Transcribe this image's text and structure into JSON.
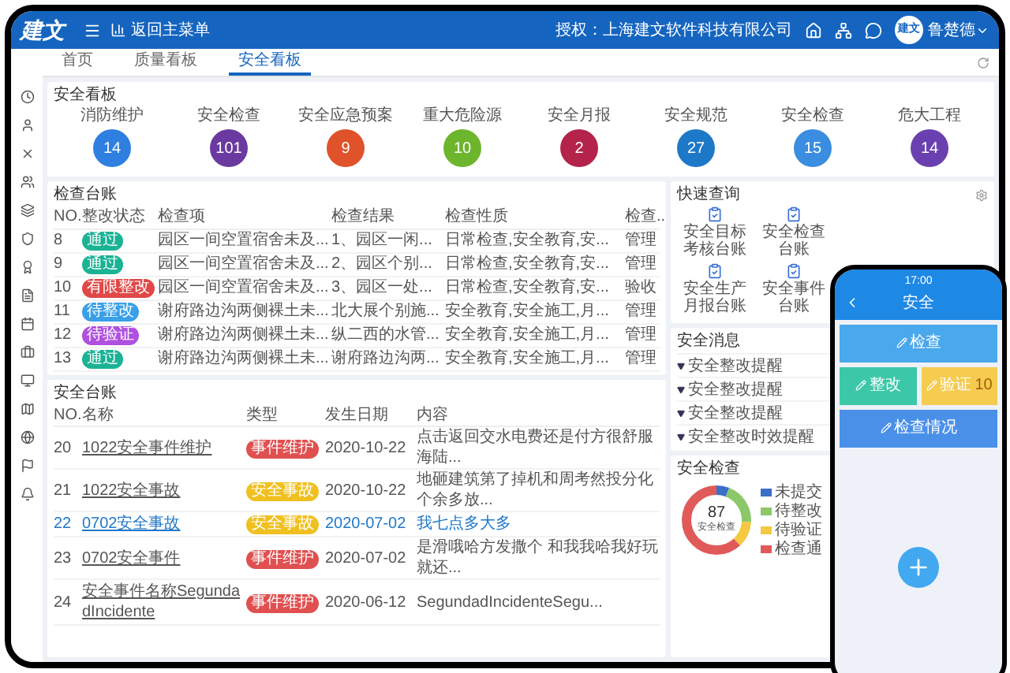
{
  "header": {
    "logo": "建文",
    "back": "返回主菜单",
    "license": "授权：上海建文软件科技有限公司",
    "avatar": "建文",
    "user": "鲁楚德"
  },
  "tabs": [
    {
      "label": "首页",
      "selected": false
    },
    {
      "label": "质量看板",
      "selected": false
    },
    {
      "label": "安全看板",
      "selected": true
    }
  ],
  "stats": {
    "title": "安全看板",
    "items": [
      {
        "label": "消防维护",
        "value": "14",
        "color": "#2f7fe0"
      },
      {
        "label": "安全检查",
        "value": "101",
        "color": "#6b3aa0"
      },
      {
        "label": "安全应急预案",
        "value": "9",
        "color": "#e0522a"
      },
      {
        "label": "重大危险源",
        "value": "10",
        "color": "#6cb52d"
      },
      {
        "label": "安全月报",
        "value": "2",
        "color": "#b3234a"
      },
      {
        "label": "安全规范",
        "value": "27",
        "color": "#1e78c8"
      },
      {
        "label": "安全检查",
        "value": "15",
        "color": "#3a8de0"
      },
      {
        "label": "危大工程",
        "value": "14",
        "color": "#6a40b0"
      }
    ]
  },
  "inspection_table": {
    "title": "检查台账",
    "columns": [
      "NO.",
      "整改状态",
      "检查项",
      "检查结果",
      "检查性质",
      "检查.."
    ],
    "rows": [
      {
        "no": "8",
        "status": "通过",
        "color": "#1ab394",
        "item": "园区一间空置宿舍未及...",
        "result": "1、园区一闲...",
        "nature": "日常检查,安全教育,安...",
        "column_6": "管理"
      },
      {
        "no": "9",
        "status": "通过",
        "color": "#1ab394",
        "item": "园区一间空置宿舍未及...",
        "result": "2、园区个别...",
        "nature": "日常检查,安全教育,安...",
        "column_6": "管理"
      },
      {
        "no": "10",
        "status": "有限整改",
        "color": "#e04848",
        "item": "园区一间空置宿舍未及...",
        "result": "3、园区一处...",
        "nature": "日常检查,安全教育,安...",
        "column_6": "验收"
      },
      {
        "no": "11",
        "status": "待整改",
        "color": "#3aa0e8",
        "item": "谢府路边沟两侧裸土未...",
        "result": "北大展个别施...",
        "nature": "安全教育,安全施工,月...",
        "column_6": "管理"
      },
      {
        "no": "12",
        "status": "待验证",
        "color": "#b050e0",
        "item": "谢府路边沟两侧裸土未...",
        "result": "纵二西的水管...",
        "nature": "安全教育,安全施工,月...",
        "column_6": "管理"
      },
      {
        "no": "13",
        "status": "通过",
        "color": "#1ab394",
        "item": "谢府路边沟两侧裸土未...",
        "result": "谢府路边沟两...",
        "nature": "安全教育,安全施工,月...",
        "column_6": "管理"
      }
    ]
  },
  "safety_table": {
    "title": "安全台账",
    "columns": [
      "NO.",
      "名称",
      "类型",
      "发生日期",
      "内容"
    ],
    "rows": [
      {
        "no": "20",
        "name": "1022安全事件维护",
        "type": "事件维护",
        "color": "#e05050",
        "date": "2020-10-22",
        "content": "点击返回交水电费还是付方很舒服海陆...",
        "selected": false
      },
      {
        "no": "21",
        "name": "1022安全事故",
        "type": "安全事故",
        "color": "#f0c020",
        "date": "2020-10-22",
        "content": "地砸建筑第了掉机和周考然投分化个余多放...",
        "selected": false
      },
      {
        "no": "22",
        "name": "0702安全事故",
        "type": "安全事故",
        "color": "#f0c020",
        "date": "2020-07-02",
        "content": "我七点多大多",
        "selected": true
      },
      {
        "no": "23",
        "name": "0702安全事件",
        "type": "事件维护",
        "color": "#e05050",
        "date": "2020-07-02",
        "content": "是滑哦哈方发撒个 和我我哈我好玩就还...",
        "selected": false
      },
      {
        "no": "24",
        "name": "安全事件名称SegundadIncidente",
        "type": "事件维护",
        "color": "#e05050",
        "date": "2020-06-12",
        "content": "SegundadIncidenteSegu...",
        "selected": false
      }
    ]
  },
  "quick_query": {
    "title": "快速查询",
    "items": [
      "安全目标考核台账",
      "安全检查台账",
      "安全生产月报台账",
      "安全事件台账"
    ]
  },
  "messages": {
    "title": "安全消息",
    "items": [
      "安全整改提醒",
      "安全整改提醒",
      "安全整改提醒",
      "安全整改时效提醒"
    ]
  },
  "safety_check": {
    "title": "安全检查",
    "total": "87",
    "caption": "安全检查",
    "legend": [
      {
        "label": "未提交",
        "color": "#3a6fc8"
      },
      {
        "label": "待整改",
        "color": "#8cc86a"
      },
      {
        "label": "待验证",
        "color": "#f5c842"
      },
      {
        "label": "检查通",
        "color": "#e05a5a"
      }
    ]
  },
  "phone": {
    "time": "17:00",
    "title": "安全",
    "tiles": [
      {
        "label": "检查",
        "color": "#4aa8ec"
      },
      {
        "label": "整改",
        "color": "#3cc8a8"
      },
      {
        "label": "验证",
        "count": "10",
        "color": "#f5cc50"
      },
      {
        "label": "检查情况",
        "color": "#4a90e8"
      }
    ]
  }
}
